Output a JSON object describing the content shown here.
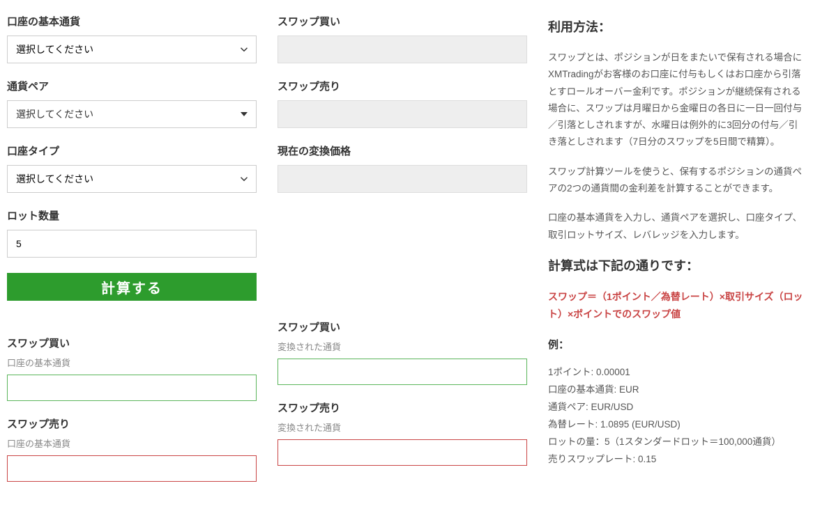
{
  "form": {
    "baseCurrency": {
      "label": "口座の基本通貨",
      "placeholder": "選択してください"
    },
    "pair": {
      "label": "通貨ペア",
      "placeholder": "選択してください"
    },
    "accountType": {
      "label": "口座タイプ",
      "placeholder": "選択してください"
    },
    "lotSize": {
      "label": "ロット数量",
      "value": "5"
    },
    "swapBuy": {
      "label": "スワップ買い"
    },
    "swapSell": {
      "label": "スワップ売り"
    },
    "currentRate": {
      "label": "現在の変換価格"
    },
    "calcButton": "計算する"
  },
  "results": {
    "swapBuyBase": {
      "title": "スワップ買い",
      "subtitle": "口座の基本通貨"
    },
    "swapSellBase": {
      "title": "スワップ売り",
      "subtitle": "口座の基本通貨"
    },
    "swapBuyConv": {
      "title": "スワップ買い",
      "subtitle": "変換された通貨"
    },
    "swapSellConv": {
      "title": "スワップ売り",
      "subtitle": "変換された通貨"
    }
  },
  "sidebar": {
    "heading": "利用方法：",
    "p1": "スワップとは、ポジションが日をまたいで保有される場合にXMTradingがお客様のお口座に付与もしくはお口座から引落とすロールオーバー金利です。ポジションが継続保有される場合に、スワップは月曜日から金曜日の各日に一日一回付与／引落としされますが、水曜日は例外的に3回分の付与／引き落としされます（7日分のスワップを5日間で精算）。",
    "p2": "スワップ計算ツールを使うと、保有するポジションの通貨ペアの2つの通貨間の金利差を計算することができます。",
    "p3": "口座の基本通貨を入力し、通貨ペアを選択し、口座タイプ、取引ロットサイズ、レバレッジを入力します。",
    "heading2": "計算式は下記の通りです：",
    "formula": "スワップ＝（1ポイント／為替レート）×取引サイズ（ロット）×ポイントでのスワップ値",
    "exampleLabel": "例：",
    "ex1": "1ポイント: 0.00001",
    "ex2": "口座の基本通貨: EUR",
    "ex3": "通貨ペア: EUR/USD",
    "ex4": "為替レート: 1.0895 (EUR/USD)",
    "ex5": "ロットの量：5（1スタンダードロット＝100,000通貨）",
    "ex6": "売りスワップレート: 0.15"
  }
}
